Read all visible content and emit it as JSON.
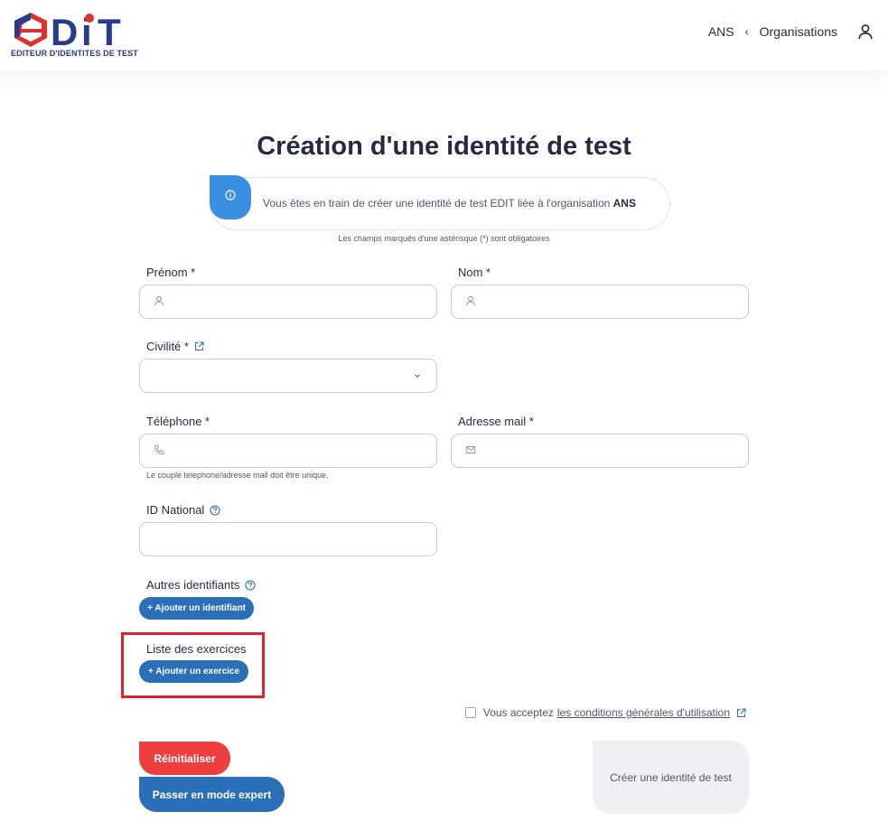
{
  "header": {
    "logo_text": "EDiT",
    "logo_subtitle": "EDITEUR D'IDENTITES DE TEST",
    "current_org": "ANS",
    "separator": "‹",
    "organisations_link": "Organisations"
  },
  "page": {
    "title": "Création d'une identité de test",
    "info_prefix": "Vous êtes en train de créer une identité de test EDIT liée à l'organisation ",
    "info_org": "ANS",
    "mandatory_note": "Les champs marqués d'une astérisque (*) sont obligatoires"
  },
  "form": {
    "prenom_label": "Prénom *",
    "prenom_value": "",
    "nom_label": "Nom *",
    "nom_value": "",
    "civilite_label": "Civilité *",
    "civilite_value": "",
    "telephone_label": "Téléphone *",
    "telephone_value": "",
    "email_label": "Adresse mail *",
    "email_value": "",
    "unique_hint": "Le couple telephone/adresse mail doit être unique.",
    "id_national_label": "ID National",
    "id_national_value": "",
    "autres_identifiants_label": "Autres identifiants",
    "add_identifiant": "+ Ajouter un identifiant",
    "exercices_label": "Liste des exercices",
    "add_exercice": "+ Ajouter un exercice",
    "terms_prefix": "Vous acceptez",
    "terms_link": "les conditions générales d'utilisation"
  },
  "actions": {
    "reset": "Réinitialiser",
    "expert": "Passer en mode expert",
    "create": "Créer une identité de test"
  },
  "colors": {
    "primary": "#2a6fb8",
    "danger": "#ef3e3e",
    "info": "#3a8fe3",
    "logo_blue": "#2a3a8c",
    "logo_red": "#e0312f",
    "highlight": "#e0212f"
  },
  "icons": {
    "user": "user-icon",
    "info": "info-icon",
    "phone": "phone-icon",
    "mail": "mail-icon",
    "chevron": "chevron-down-icon",
    "external": "external-link-icon",
    "help": "question-icon"
  }
}
